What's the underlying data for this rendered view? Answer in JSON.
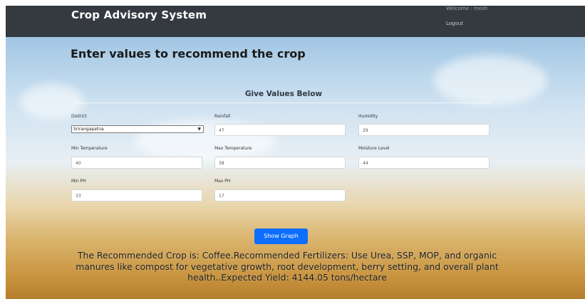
{
  "navbar": {
    "brand": "Crop Advisory System",
    "welcome": "Welcome : mesh",
    "logout": "Logout"
  },
  "page": {
    "heading": "Enter values to recommend the crop",
    "subheading": "Give Values Below"
  },
  "form": {
    "district": {
      "label": "District",
      "value": "Srirangapatna"
    },
    "rainfall": {
      "label": "Rainfall",
      "value": "47"
    },
    "humidity": {
      "label": "Humidity",
      "value": "29"
    },
    "min_temperature": {
      "label": "Min Temperature",
      "value": "40"
    },
    "max_temperature": {
      "label": "Max Temperature",
      "value": "38"
    },
    "moisture_level": {
      "label": "Moisture Level",
      "value": "44"
    },
    "min_ph": {
      "label": "Min PH",
      "value": "33"
    },
    "max_ph": {
      "label": "Max PH",
      "value": "17"
    },
    "show_graph_label": "Show Graph"
  },
  "result": {
    "text": "The Recommended Crop is: Coffee.Recommended Fertilizers: Use Urea, SSP, MOP, and organic manures like compost for vegetative growth, root development, berry setting, and overall plant health..Expected Yield: 4144.05 tons/hectare"
  },
  "colors": {
    "navbar": "#343a40",
    "button": "#0d6efd"
  }
}
